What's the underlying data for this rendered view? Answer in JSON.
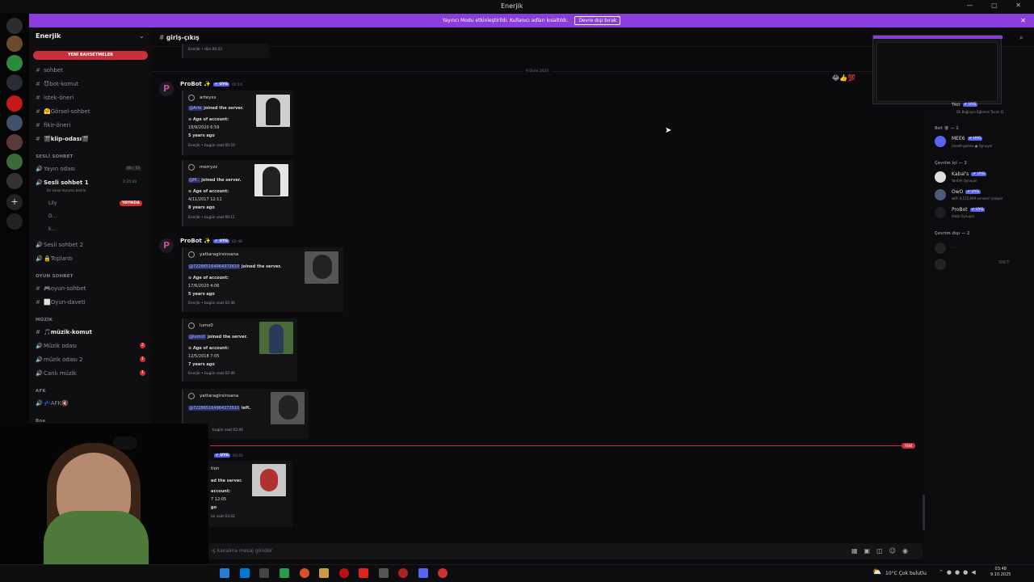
{
  "window": {
    "title": "Enerjik"
  },
  "banner": {
    "text": "Yayıncı Modu etkinleştirildi. Kullanıcı adları kısaltıldı.",
    "button": "Devre dışı bırak"
  },
  "server": {
    "name": "Enerjik",
    "new_messages_pill": "YENİ BAHSETMELER"
  },
  "sidebar": {
    "channels_top": [
      {
        "name": "sohbet"
      },
      {
        "name": "😈bot-komut"
      },
      {
        "name": "istek-öneri"
      },
      {
        "name": "🤗Görsel-sohbet"
      },
      {
        "name": "fikir-öneri"
      },
      {
        "name": "🎬klip-odası🎬"
      }
    ],
    "voice_category": "SESLİ SOHBET",
    "voice_channels": [
      {
        "name": "Yayın odası",
        "count": "00 / 73"
      },
      {
        "name": "Sesli sohbet 1",
        "timer": "2:35:40",
        "status": "Bir kanal durumu belirle"
      },
      {
        "name": "Sesli sohbet 2"
      },
      {
        "name": "🔒Toplantı"
      }
    ],
    "voice_users": [
      "Lily",
      "D...",
      "k..."
    ],
    "live_badge": "YAYINDA",
    "game_category": "OYUN SOHBET",
    "game_channels": [
      {
        "name": "🎮oyun-sohbet"
      },
      {
        "name": "⬜Oyun-daveti"
      }
    ],
    "music_category": "MÜZİK",
    "music_channels": [
      {
        "name": "🎵müzik-komut"
      },
      {
        "name": "Müzik odası",
        "badge": "2"
      },
      {
        "name": "müzik odası 2",
        "badge": "1"
      },
      {
        "name": "Canlı müzik",
        "badge": "1"
      }
    ],
    "afk_category": "AFK",
    "afk_channel": "💤AFK🔇",
    "extra_category": "Boe"
  },
  "header": {
    "channel": "giriş-çıkış"
  },
  "messages": {
    "date_separator": "9 Ekim 2025",
    "top_footer": "Enerjik • dün 04:23",
    "groups": [
      {
        "author": "ProBot ✨",
        "tag": "✔ UYG",
        "time": "00:10",
        "embeds": [
          {
            "user": "arteyxs",
            "mention": "@Arte",
            "joined": "joined the server.",
            "age_label": "⊙ Age of account:",
            "date": "18/9/2020 6:59",
            "ago": "5 years ago",
            "footer": "Enerjik • bugün saat 00:10"
          },
          {
            "user": "merryzz",
            "mention": "@M..",
            "joined": "joined the server.",
            "age_label": "⊙ Age of account:",
            "date": "4/11/2017 12:11",
            "ago": "8 years ago",
            "footer": "Enerjik • bugün saat 00:11"
          }
        ]
      },
      {
        "author": "ProBot ✨",
        "tag": "✔ UYG",
        "time": "02:46",
        "embeds": [
          {
            "user": "yattaragirsinsana",
            "mention": "@722865164964372610",
            "joined": "joined the server.",
            "age_label": "⊙ Age of account:",
            "date": "17/6/2020 4:06",
            "ago": "5 years ago",
            "footer": "Enerjik • bugün saat 02:46"
          },
          {
            "user": "lums0",
            "mention": "@lums0",
            "joined": "joined the server.",
            "age_label": "⊙ Age of account:",
            "date": "12/5/2018 7:05",
            "ago": "7 years ago",
            "footer": "Enerjik • bugün saat 02:46"
          },
          {
            "user": "yattaragirsinsana",
            "mention": "@722865164964372610",
            "joined": "left.",
            "footer": "bugün saat 02:46"
          }
        ]
      },
      {
        "author": "",
        "tag": "✔ UYG",
        "time": "03:42",
        "embeds": [
          {
            "user": "tion",
            "joined": "ed the server.",
            "age_label": "account:",
            "date": "7 12:05",
            "ago": "go",
            "footer": "ün saat 03:42"
          }
        ]
      }
    ],
    "new_label": "YENİ"
  },
  "composer": {
    "placeholder": "ış kanalına mesaj gönder"
  },
  "members": {
    "groups": [
      {
        "category": "Bot 🛡 — 1"
      },
      {
        "category": "Çevrim içi — 3"
      },
      {
        "category": "Çevrim dışı — 2"
      }
    ],
    "list": [
      {
        "name": "Tikit",
        "tag": "✔ UYG",
        "sub": "Dil Bağlayın Eğlence Tacım D..."
      },
      {
        "name": "MEE6",
        "tag": "✔ UYG",
        "sub": "/mee6-games ● Oynuyor"
      },
      {
        "name": "Kabal's",
        "tag": "✔ UYG",
        "sub": "Yardım Oynuyor"
      },
      {
        "name": "OwO",
        "tag": "✔ UYG",
        "sub": "with 4,572,699 servers! yazıyor"
      },
      {
        "name": "ProBot",
        "tag": "✔ UYG",
        "sub": "/help Oynuyor"
      },
      {
        "name": "...",
        "tag": "",
        "sub": ""
      },
      {
        "name": "",
        "tag": "SNCT",
        "sub": ""
      }
    ]
  },
  "taskbar": {
    "weather": "10°C Çok bulutlu",
    "time": "03:48",
    "date": "9.10.2025"
  }
}
